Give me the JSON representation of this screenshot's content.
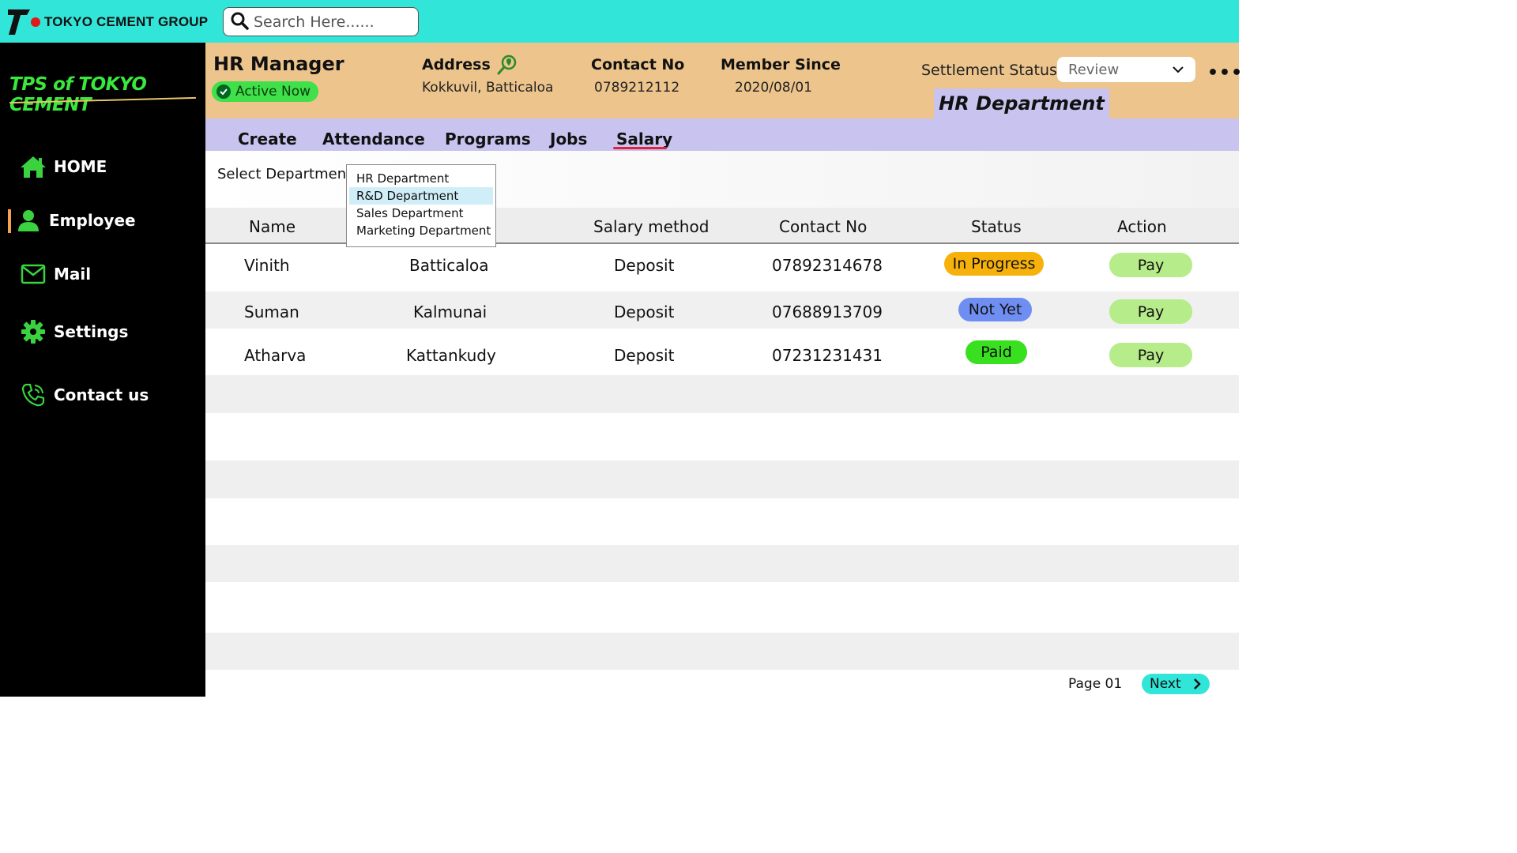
{
  "topbar": {
    "brand": "TOKYO CEMENT GROUP",
    "search_placeholder": "Search Here......",
    "accent_color": "#31e5d9"
  },
  "sidebar": {
    "title": "TPS of TOKYO CEMENT",
    "items": [
      {
        "label": "HOME",
        "icon": "home-icon"
      },
      {
        "label": "Employee",
        "icon": "user-icon",
        "active": true
      },
      {
        "label": "Mail",
        "icon": "mail-icon"
      },
      {
        "label": "Settings",
        "icon": "gear-icon"
      },
      {
        "label": "Contact us",
        "icon": "phone-icon"
      }
    ]
  },
  "profile": {
    "role": "HR Manager",
    "status": "Active Now",
    "address_label": "Address",
    "address_value": "Kokkuvil, Batticaloa",
    "contact_label": "Contact No",
    "contact_value": "0789212112",
    "member_label": "Member Since",
    "member_value": "2020/08/01",
    "settlement_label": "Settlement Status",
    "settlement_value": "Review",
    "department_tab": "HR Department"
  },
  "tabs": [
    {
      "label": "Create"
    },
    {
      "label": "Attendance"
    },
    {
      "label": "Programs"
    },
    {
      "label": "Jobs"
    },
    {
      "label": "Salary",
      "active": true
    }
  ],
  "filter": {
    "label": "Select Department",
    "options": [
      "HR Department",
      "R&D Department",
      "Sales Department",
      "Marketing Department"
    ],
    "highlighted": "R&D Department"
  },
  "table": {
    "headers": [
      "Name",
      "",
      "Salary method",
      "Contact No",
      "Status",
      "Action"
    ],
    "rows": [
      {
        "name": "Vinith",
        "city": "Batticaloa",
        "method": "Deposit",
        "contact": "07892314678",
        "status": "In Progress",
        "status_color": "#f6b10a",
        "action": "Pay"
      },
      {
        "name": "Suman",
        "city": "Kalmunai",
        "method": "Deposit",
        "contact": "07688913709",
        "status": "Not Yet",
        "status_color": "#6f8ef2",
        "action": "Pay"
      },
      {
        "name": "Atharva",
        "city": "Kattankudy",
        "method": "Deposit",
        "contact": "07231231431",
        "status": "Paid",
        "status_color": "#39e01f",
        "action": "Pay"
      }
    ]
  },
  "pagination": {
    "page_label": "Page 01",
    "next_label": "Next"
  }
}
